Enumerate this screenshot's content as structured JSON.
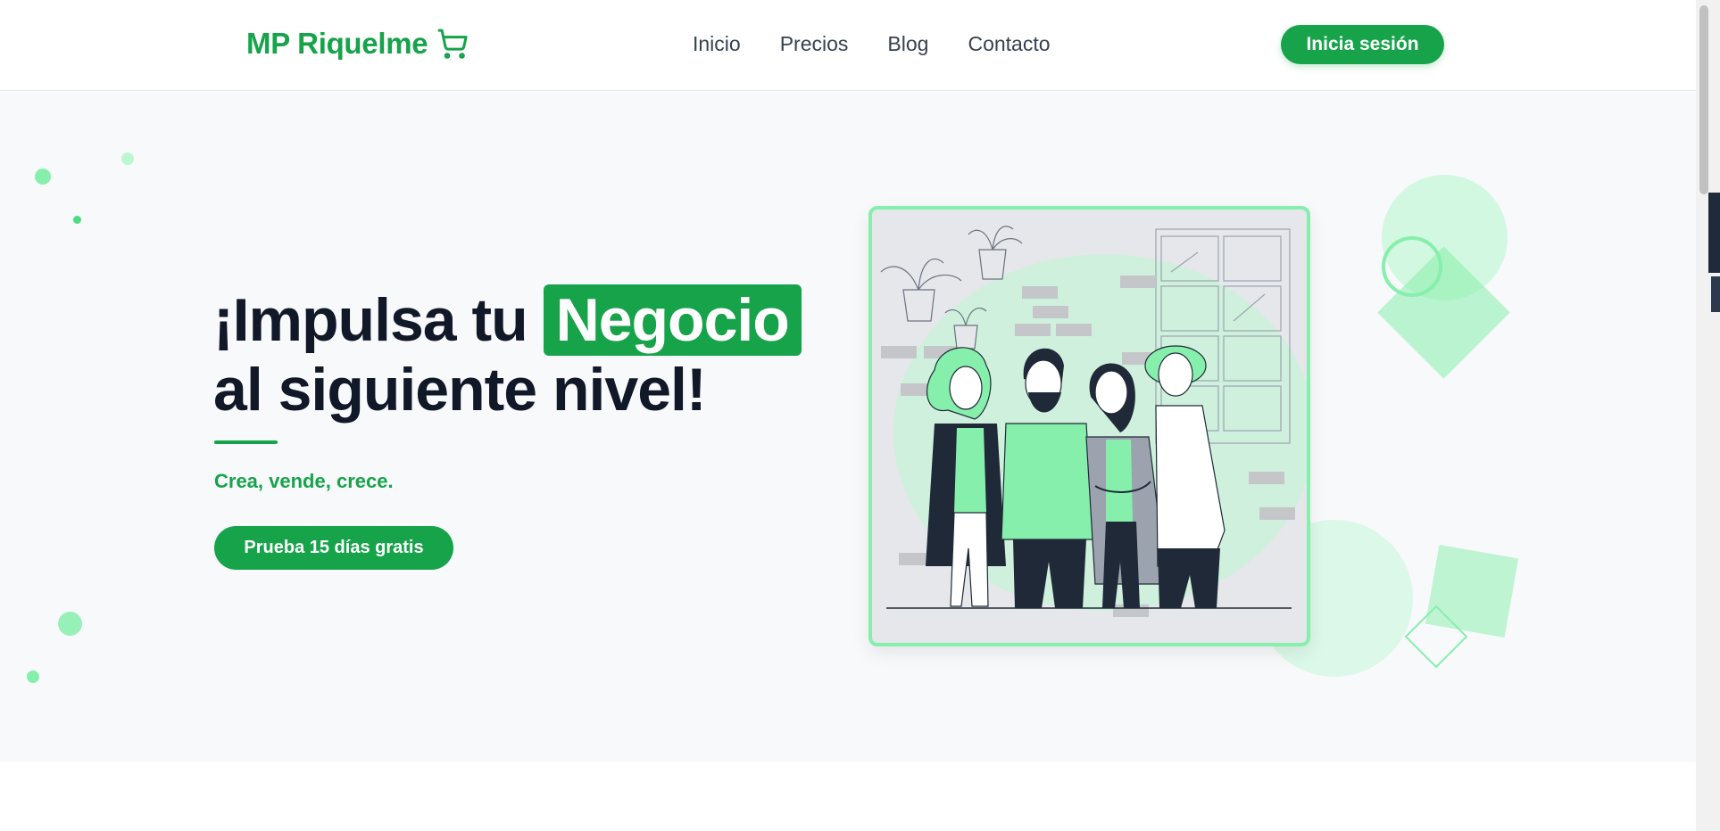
{
  "header": {
    "brand": "MP Riquelme",
    "brand_icon": "cart-icon",
    "nav": [
      "Inicio",
      "Precios",
      "Blog",
      "Contacto"
    ],
    "login_label": "Inicia sesión"
  },
  "hero": {
    "title_part1": "¡Impulsa tu",
    "title_highlight": "Negocio",
    "title_part2": "al siguiente nivel!",
    "tagline": "Crea, vende, crece.",
    "cta_label": "Prueba 15 días gratis",
    "illustration": "team-illustration"
  },
  "colors": {
    "primary": "#16a34a",
    "primary_light": "#86efac",
    "hero_bg": "#f8f9fb",
    "text_dark": "#111827"
  }
}
